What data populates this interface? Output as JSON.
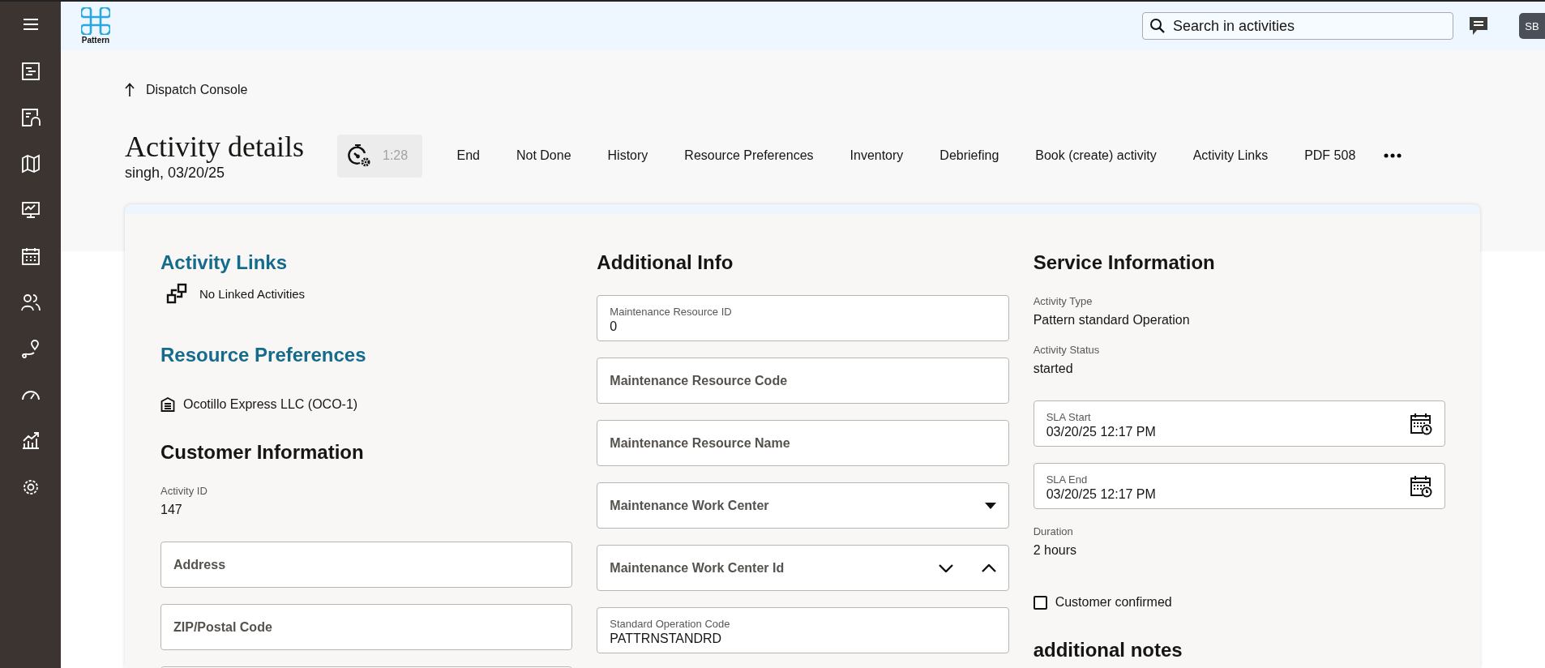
{
  "header": {
    "logo_text": "Pattern",
    "search": {
      "placeholder": "Search in activities"
    },
    "avatar": "SB"
  },
  "back_link": "Dispatch Console",
  "title": "Activity details",
  "subtitle": "singh, 03/20/25",
  "timer": {
    "time": "1:28"
  },
  "actions": [
    "End",
    "Not Done",
    "History",
    "Resource Preferences",
    "Inventory",
    "Debriefing",
    "Book (create) activity",
    "Activity Links",
    "PDF 508"
  ],
  "columns": [
    {
      "items": [
        {
          "kind": "link_heading",
          "text": "Activity Links"
        },
        {
          "kind": "linked",
          "text": "No Linked Activities"
        },
        {
          "kind": "link_heading",
          "text": "Resource Preferences"
        },
        {
          "kind": "resource",
          "text": "Ocotillo Express LLC (OCO-1)"
        },
        {
          "kind": "heading",
          "text": "Customer Information"
        },
        {
          "kind": "readonly",
          "label": "Activity ID",
          "value": "147"
        },
        {
          "kind": "field",
          "label": "Address"
        },
        {
          "kind": "field",
          "label": "ZIP/Postal Code"
        },
        {
          "kind": "field"
        }
      ]
    },
    {
      "items": [
        {
          "kind": "heading",
          "text": "Additional Info"
        },
        {
          "kind": "field",
          "label": "Maintenance Resource ID",
          "value": "0"
        },
        {
          "kind": "field",
          "label": "Maintenance Resource Code"
        },
        {
          "kind": "field",
          "label": "Maintenance Resource Name"
        },
        {
          "kind": "select",
          "label": "Maintenance Work Center"
        },
        {
          "kind": "spinner",
          "label": "Maintenance Work Center Id"
        },
        {
          "kind": "field",
          "label": "Standard Operation Code",
          "value": "PATTRNSTANDRD"
        }
      ]
    },
    {
      "items": [
        {
          "kind": "heading",
          "text": "Service Information"
        },
        {
          "kind": "readonly",
          "label": "Activity Type",
          "value": "Pattern standard Operation"
        },
        {
          "kind": "readonly",
          "label": "Activity Status",
          "value": "started"
        },
        {
          "kind": "datetime",
          "label": "SLA Start",
          "value": "03/20/25 12:17 PM"
        },
        {
          "kind": "datetime",
          "label": "SLA End",
          "value": "03/20/25 12:17 PM"
        },
        {
          "kind": "readonly",
          "label": "Duration",
          "value": "2 hours"
        },
        {
          "kind": "checkbox",
          "label": "Customer confirmed",
          "checked": false
        },
        {
          "kind": "heading",
          "text": "additional notes"
        }
      ]
    }
  ]
}
